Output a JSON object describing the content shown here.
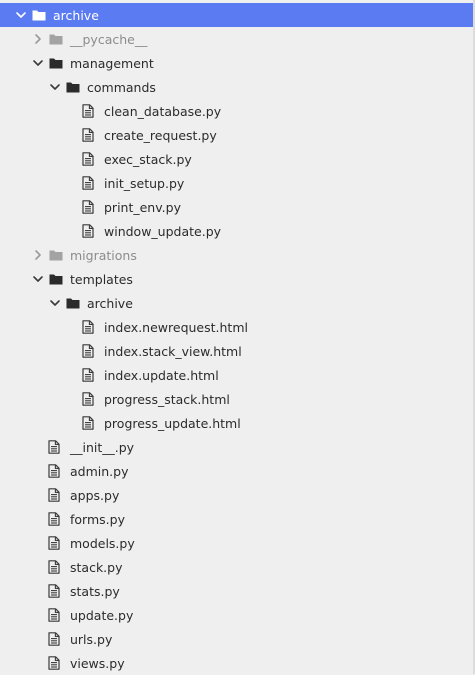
{
  "colors": {
    "selection": "#5b7bf2",
    "folder": "#2b2b2b",
    "folder_muted": "#a3a3a3",
    "text": "#2b2b2b",
    "text_muted": "#8c8c8c",
    "background": "#efefef"
  },
  "tree": [
    {
      "label": "archive",
      "kind": "folder",
      "depth": 0,
      "expanded": true,
      "selected": true,
      "muted": false
    },
    {
      "label": "__pycache__",
      "kind": "folder",
      "depth": 1,
      "expanded": false,
      "selected": false,
      "muted": true
    },
    {
      "label": "management",
      "kind": "folder",
      "depth": 1,
      "expanded": true,
      "selected": false,
      "muted": false
    },
    {
      "label": "commands",
      "kind": "folder",
      "depth": 2,
      "expanded": true,
      "selected": false,
      "muted": false
    },
    {
      "label": "clean_database.py",
      "kind": "file",
      "depth": 3,
      "selected": false,
      "muted": false
    },
    {
      "label": "create_request.py",
      "kind": "file",
      "depth": 3,
      "selected": false,
      "muted": false
    },
    {
      "label": "exec_stack.py",
      "kind": "file",
      "depth": 3,
      "selected": false,
      "muted": false
    },
    {
      "label": "init_setup.py",
      "kind": "file",
      "depth": 3,
      "selected": false,
      "muted": false
    },
    {
      "label": "print_env.py",
      "kind": "file",
      "depth": 3,
      "selected": false,
      "muted": false
    },
    {
      "label": "window_update.py",
      "kind": "file",
      "depth": 3,
      "selected": false,
      "muted": false
    },
    {
      "label": "migrations",
      "kind": "folder",
      "depth": 1,
      "expanded": false,
      "selected": false,
      "muted": true
    },
    {
      "label": "templates",
      "kind": "folder",
      "depth": 1,
      "expanded": true,
      "selected": false,
      "muted": false
    },
    {
      "label": "archive",
      "kind": "folder",
      "depth": 2,
      "expanded": true,
      "selected": false,
      "muted": false
    },
    {
      "label": "index.newrequest.html",
      "kind": "file",
      "depth": 3,
      "selected": false,
      "muted": false
    },
    {
      "label": "index.stack_view.html",
      "kind": "file",
      "depth": 3,
      "selected": false,
      "muted": false
    },
    {
      "label": "index.update.html",
      "kind": "file",
      "depth": 3,
      "selected": false,
      "muted": false
    },
    {
      "label": "progress_stack.html",
      "kind": "file",
      "depth": 3,
      "selected": false,
      "muted": false
    },
    {
      "label": "progress_update.html",
      "kind": "file",
      "depth": 3,
      "selected": false,
      "muted": false
    },
    {
      "label": "__init__.py",
      "kind": "file",
      "depth": 1,
      "selected": false,
      "muted": false
    },
    {
      "label": "admin.py",
      "kind": "file",
      "depth": 1,
      "selected": false,
      "muted": false
    },
    {
      "label": "apps.py",
      "kind": "file",
      "depth": 1,
      "selected": false,
      "muted": false
    },
    {
      "label": "forms.py",
      "kind": "file",
      "depth": 1,
      "selected": false,
      "muted": false
    },
    {
      "label": "models.py",
      "kind": "file",
      "depth": 1,
      "selected": false,
      "muted": false
    },
    {
      "label": "stack.py",
      "kind": "file",
      "depth": 1,
      "selected": false,
      "muted": false
    },
    {
      "label": "stats.py",
      "kind": "file",
      "depth": 1,
      "selected": false,
      "muted": false
    },
    {
      "label": "update.py",
      "kind": "file",
      "depth": 1,
      "selected": false,
      "muted": false
    },
    {
      "label": "urls.py",
      "kind": "file",
      "depth": 1,
      "selected": false,
      "muted": false
    },
    {
      "label": "views.py",
      "kind": "file",
      "depth": 1,
      "selected": false,
      "muted": false
    }
  ]
}
